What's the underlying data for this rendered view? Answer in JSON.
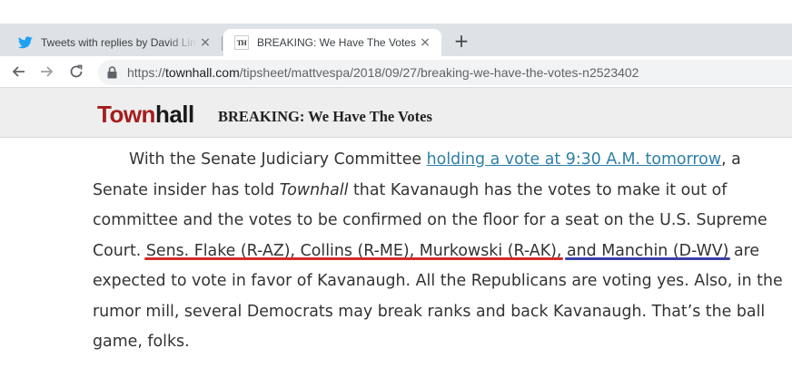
{
  "browser": {
    "tabs": [
      {
        "title": "Tweets with replies by David Limbaugh",
        "favicon": "twitter-icon",
        "active": false
      },
      {
        "title": "BREAKING: We Have The Votes",
        "favicon": "townhall-icon",
        "favicon_text": "TH",
        "active": true
      }
    ],
    "new_tab_label": "+",
    "close_glyph": "×",
    "url_scheme": "https://",
    "url_host": "townhall.com",
    "url_path": "/tipsheet/mattvespa/2018/09/27/breaking-we-have-the-votes-n2523402"
  },
  "site": {
    "logo_part1": "Town",
    "logo_part2": "hall",
    "header_title": "BREAKING: We Have The Votes",
    "brand_color": "#a51d1d"
  },
  "article": {
    "p1_before_link": "With the Senate Judiciary Committee ",
    "link_text": "holding a vote at 9:30 A.M. tomorrow",
    "p1_after_link": ", a Senate insider has told ",
    "italic_name": "Townhall",
    "p1_after_italic": " that Kavanaugh has the votes to make it out of committee and the votes to be confirmed on the floor for a seat on the U.S. Supreme Court. ",
    "highlight_red": "Sens. Flake (R-AZ), Collins (R-ME), Murkowski (R-AK),",
    "space": " ",
    "highlight_blue": "and Manchin (D-WV)",
    "p1_end": " are expected to vote in favor of Kavanaugh. All the Republicans are voting yes. Also, in the rumor mill, several Democrats may break ranks and back Kavanaugh. That’s the ball game, folks.",
    "link_color": "#2d7fa6",
    "underline_colors": {
      "red": "#d42a2a",
      "blue": "#3a3fa8"
    }
  }
}
